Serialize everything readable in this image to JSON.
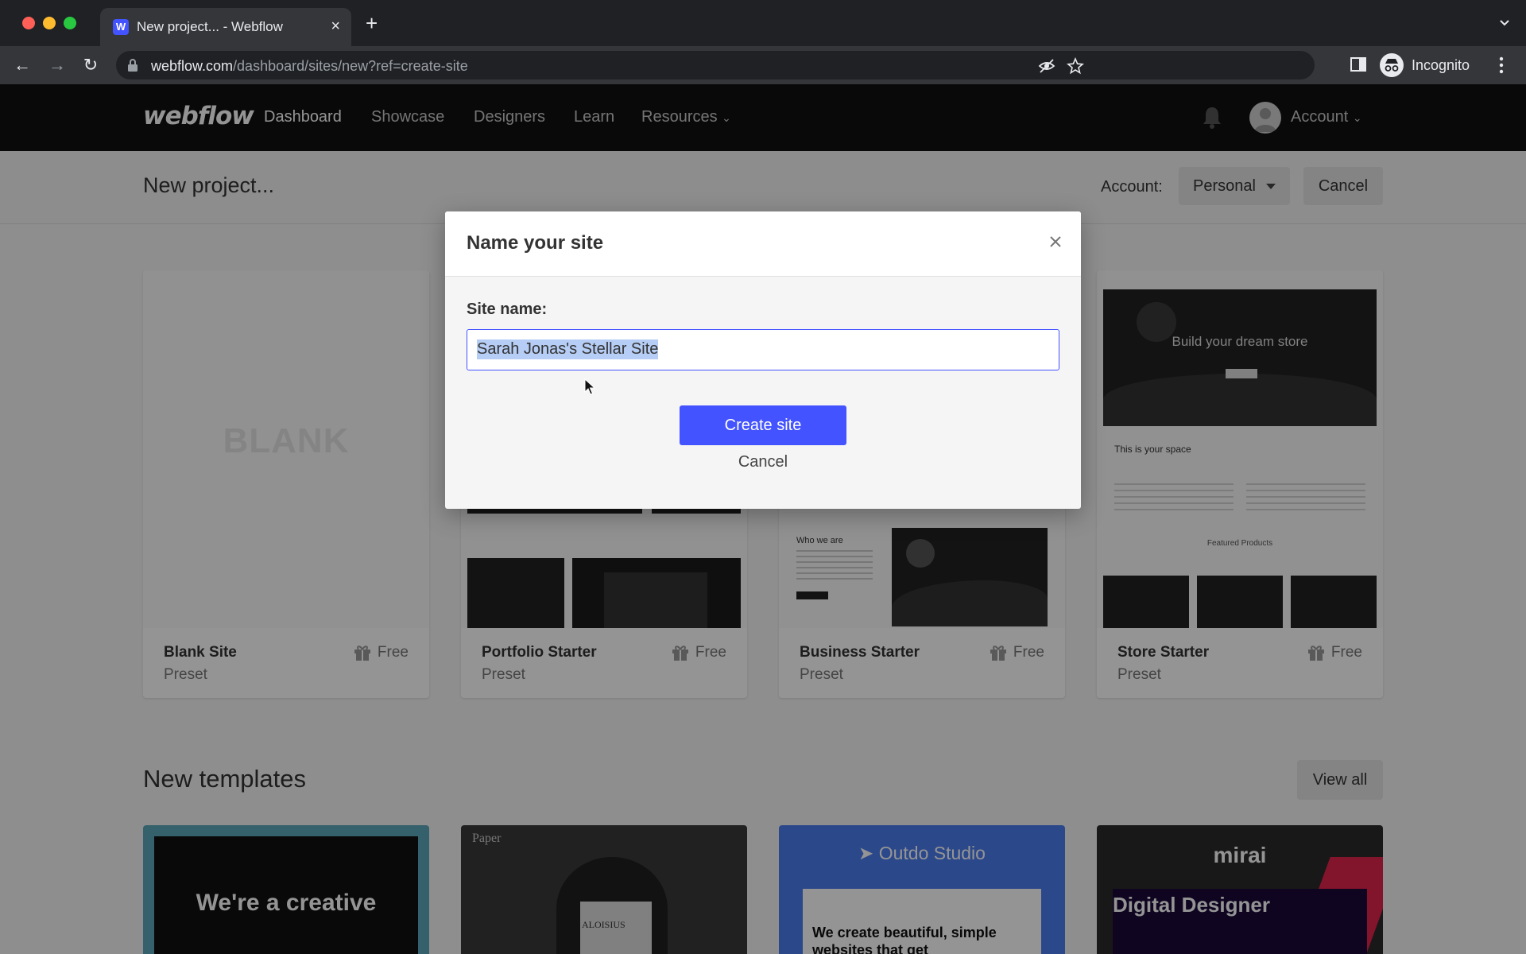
{
  "browser": {
    "tab_title": "New project... - Webflow",
    "favicon_letter": "W",
    "url_host": "webflow.com",
    "url_path": "/dashboard/sites/new?ref=create-site",
    "incognito_label": "Incognito"
  },
  "nav": {
    "logo": "webflow",
    "links": [
      "Dashboard",
      "Showcase",
      "Designers",
      "Learn",
      "Resources"
    ],
    "account": "Account"
  },
  "subheader": {
    "title": "New project...",
    "account_label": "Account:",
    "account_value": "Personal",
    "cancel": "Cancel"
  },
  "presets": [
    {
      "title": "Blank Site",
      "subtitle": "Preset",
      "badge": "Free",
      "thumb_text": "BLANK"
    },
    {
      "title": "Portfolio Starter",
      "subtitle": "Preset",
      "badge": "Free"
    },
    {
      "title": "Business Starter",
      "subtitle": "Preset",
      "badge": "Free",
      "thumb_text": "Who we are"
    },
    {
      "title": "Store Starter",
      "subtitle": "Preset",
      "badge": "Free",
      "thumb_text": "Build your dream store",
      "thumb_text2": "This is your space",
      "thumb_text3": "Featured Products"
    }
  ],
  "templates": {
    "title": "New templates",
    "view_all": "View all",
    "items": [
      {
        "text": "We're a creative"
      },
      {
        "text": "Paper",
        "text2": "ALOISIUS"
      },
      {
        "text": "Outdo Studio",
        "text2": "We create beautiful, simple websites that get"
      },
      {
        "text": "mirai",
        "text2": "Digital Designer"
      }
    ]
  },
  "modal": {
    "title": "Name your site",
    "field_label": "Site name:",
    "field_value": "Sarah Jonas's Stellar Site",
    "create_button": "Create site",
    "cancel": "Cancel"
  },
  "colors": {
    "accent": "#4353ff",
    "nav_bg": "#111111"
  }
}
